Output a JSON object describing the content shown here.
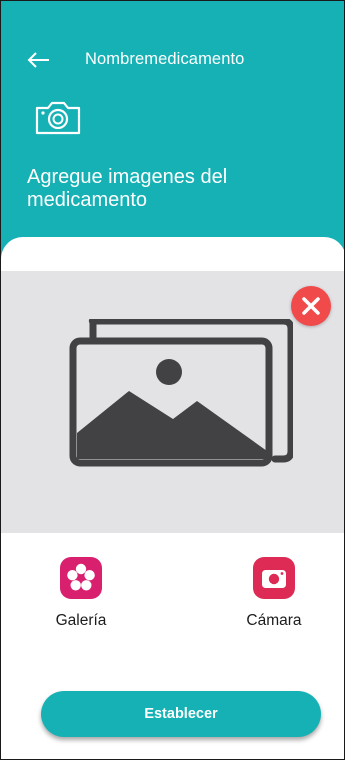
{
  "header": {
    "back_icon": "arrow-left-icon",
    "title": "Nombremedicamento",
    "camera_icon": "camera-outline-icon",
    "heading": "Agregue imagenes del medicamento",
    "background_color": "#16b1b5"
  },
  "preview": {
    "placeholder_icon": "image-stack-icon",
    "remove_icon": "close-circle-icon",
    "remove_color": "#f04a4a"
  },
  "options": [
    {
      "label": "Galería",
      "icon": "flower-gallery-icon",
      "color": "#d8206f"
    },
    {
      "label": "Cámara",
      "icon": "camera-app-icon",
      "color": "#dd2b55"
    }
  ],
  "actions": {
    "submit_label": "Establecer",
    "button_color": "#16b1b5"
  }
}
